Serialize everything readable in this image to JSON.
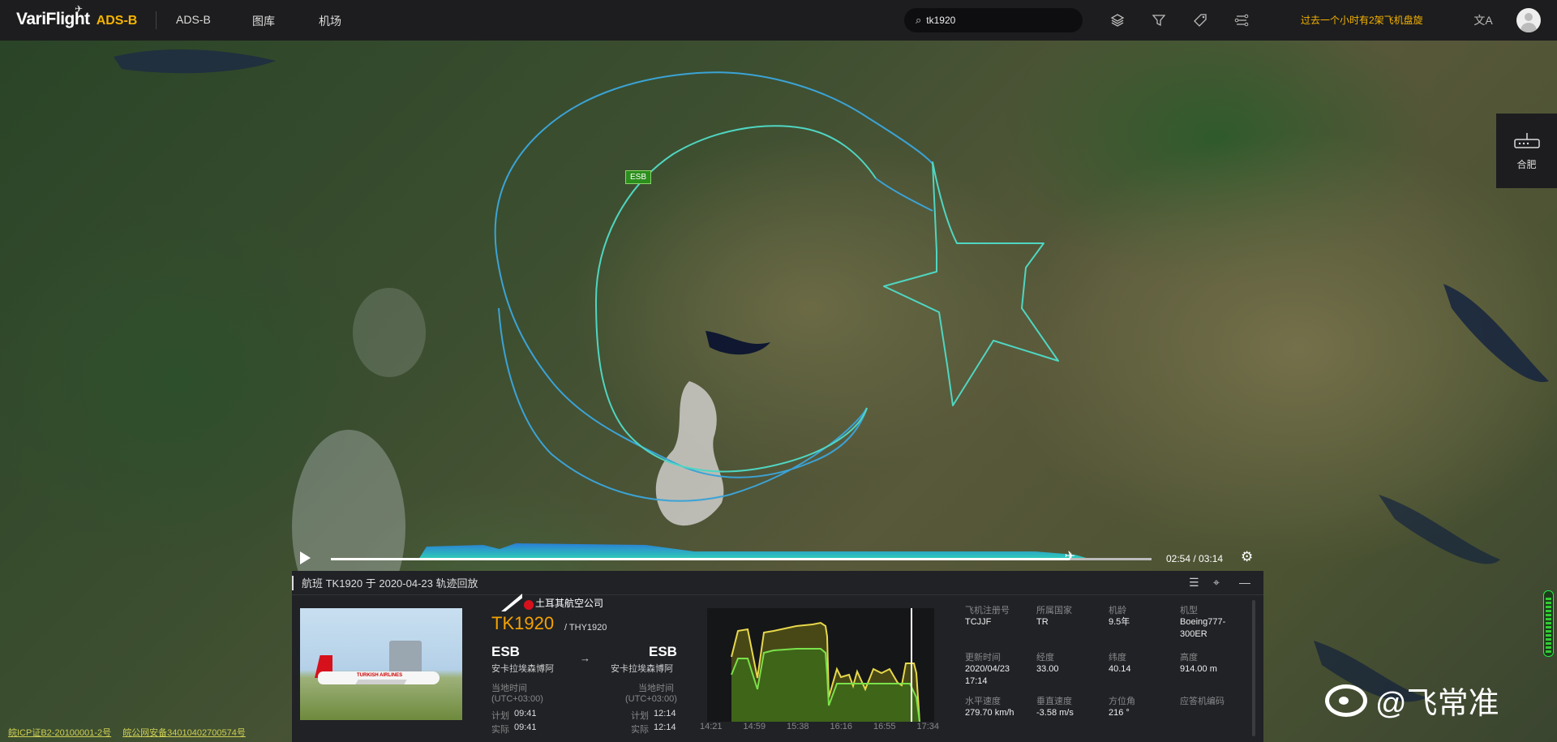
{
  "header": {
    "logo_text": "VariFlight",
    "logo_sub": "ADS-B",
    "nav": [
      "ADS-B",
      "图库",
      "机场"
    ],
    "search_value": "tk1920",
    "notice": "过去一个小时有2架飞机盘旋"
  },
  "icons": {
    "search": "search-icon",
    "layers": "layers-icon",
    "filter": "filter-icon",
    "tag": "tag-icon",
    "route": "route-icon",
    "language": "language-icon",
    "avatar": "user-avatar-icon"
  },
  "right_widget": {
    "label": "合肥"
  },
  "map": {
    "airport_label": "ESB"
  },
  "playback": {
    "time": "02:54 / 03:14",
    "progress": 0.9
  },
  "panel": {
    "title": "航班 TK1920 于 2020-04-23 轨迹回放",
    "airline": "土耳其航空公司",
    "flight_no": "TK1920",
    "flight_no_alt": "/ THY1920",
    "origin": {
      "code": "ESB",
      "name": "安卡拉埃森博阿"
    },
    "dest": {
      "code": "ESB",
      "name": "安卡拉埃森博阿"
    },
    "local_time_label": "当地时间",
    "tz": "(UTC+03:00)",
    "sched_label": "计划",
    "actual_label": "实际",
    "origin_sched": "09:41",
    "origin_actual": "09:41",
    "dest_sched": "12:14",
    "dest_actual": "12:14",
    "chart_ticks": [
      "14:21",
      "14:59",
      "15:38",
      "16:16",
      "16:55",
      "17:34"
    ],
    "details": [
      {
        "label": "飞机注册号",
        "value": "TCJJF"
      },
      {
        "label": "所属国家",
        "value": "TR"
      },
      {
        "label": "机龄",
        "value": "9.5年"
      },
      {
        "label": "机型",
        "value": "Boeing777-300ER"
      },
      {
        "label": "更新时间",
        "value": "2020/04/23 17:14"
      },
      {
        "label": "经度",
        "value": "33.00"
      },
      {
        "label": "纬度",
        "value": "40.14"
      },
      {
        "label": "高度",
        "value": "914.00 m"
      },
      {
        "label": "水平速度",
        "value": "279.70 km/h"
      },
      {
        "label": "垂直速度",
        "value": "-3.58 m/s"
      },
      {
        "label": "方位角",
        "value": "216 °"
      },
      {
        "label": "应答机编码",
        "value": ""
      }
    ]
  },
  "footer": {
    "icp": "皖ICP证B2-20100001-2号",
    "police": "皖公网安备34010402700574号"
  },
  "watermark": "@飞常准",
  "colors": {
    "accent": "#f5b300",
    "track_outer": "#3ba3d6",
    "track_inner": "#4fd6c2",
    "chart_yellow": "#e8d84a",
    "chart_green": "#7ae04a"
  }
}
